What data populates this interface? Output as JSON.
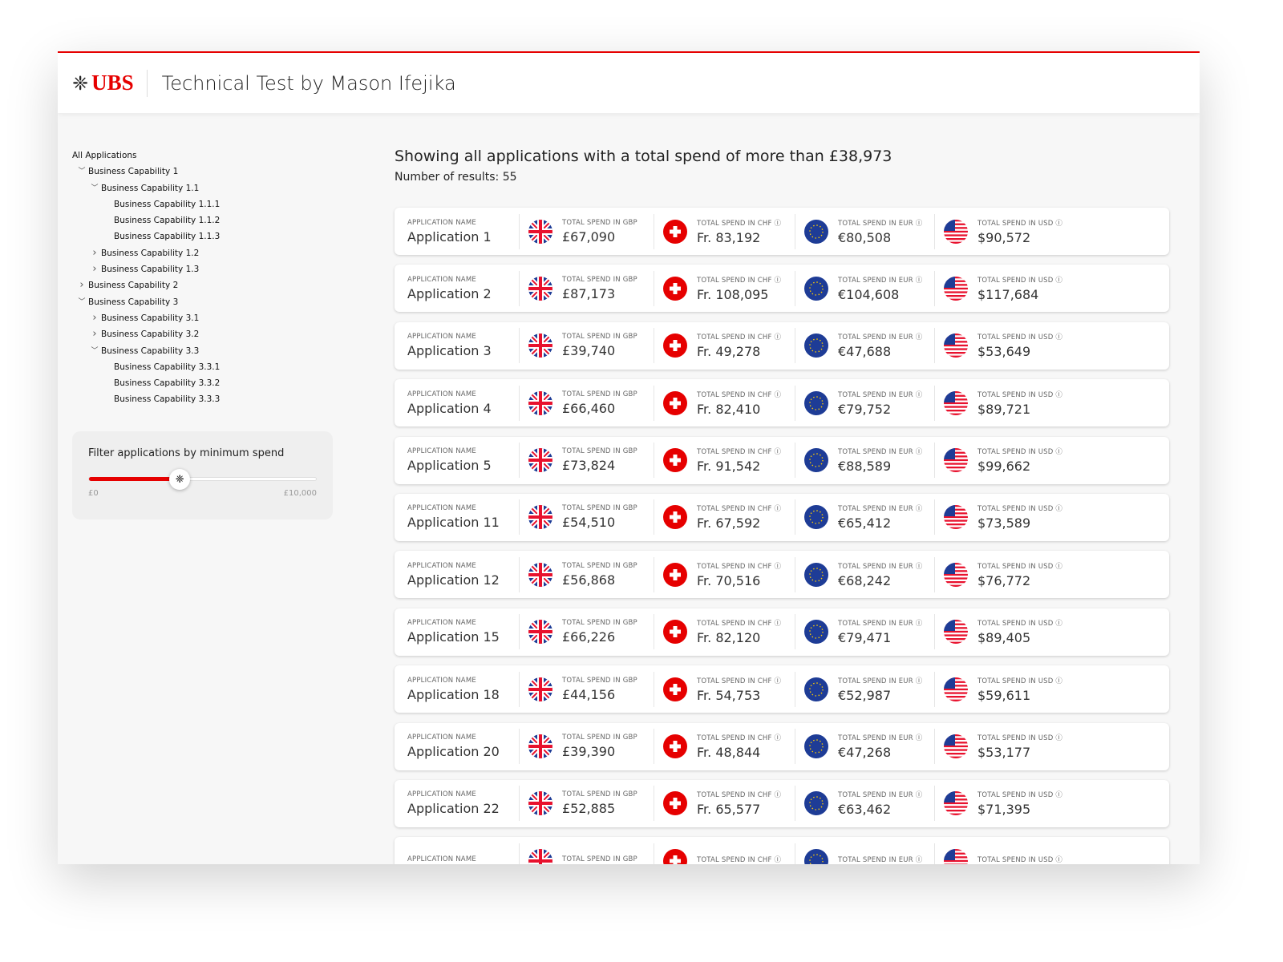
{
  "header": {
    "brand": "UBS",
    "title": "Technical Test by Mason Ifejika"
  },
  "sidebar": {
    "items": [
      {
        "label": "All Applications",
        "level": 0,
        "chevron": "none"
      },
      {
        "label": "Business Capability 1",
        "level": 1,
        "chevron": "down"
      },
      {
        "label": "Business Capability 1.1",
        "level": 2,
        "chevron": "down"
      },
      {
        "label": "Business Capability 1.1.1",
        "level": 3,
        "chevron": "none"
      },
      {
        "label": "Business Capability 1.1.2",
        "level": 3,
        "chevron": "none"
      },
      {
        "label": "Business Capability 1.1.3",
        "level": 3,
        "chevron": "none"
      },
      {
        "label": "Business Capability 1.2",
        "level": 2,
        "chevron": "right"
      },
      {
        "label": "Business Capability 1.3",
        "level": 2,
        "chevron": "right"
      },
      {
        "label": "Business Capability 2",
        "level": 1,
        "chevron": "right"
      },
      {
        "label": "Business Capability 3",
        "level": 1,
        "chevron": "down"
      },
      {
        "label": "Business Capability 3.1",
        "level": 2,
        "chevron": "right"
      },
      {
        "label": "Business Capability 3.2",
        "level": 2,
        "chevron": "right"
      },
      {
        "label": "Business Capability 3.3",
        "level": 2,
        "chevron": "down"
      },
      {
        "label": "Business Capability 3.3.1",
        "level": 3,
        "chevron": "none"
      },
      {
        "label": "Business Capability 3.3.2",
        "level": 3,
        "chevron": "none"
      },
      {
        "label": "Business Capability 3.3.3",
        "level": 3,
        "chevron": "none"
      }
    ]
  },
  "filter": {
    "label": "Filter applications by minimum spend",
    "min_label": "£0",
    "max_label": "£10,000",
    "slider_fraction": 0.4,
    "accent": "#e60000"
  },
  "main": {
    "heading": "Showing all applications with a total spend of more than £38,973",
    "count": "Number of results: 55",
    "labels": {
      "name": "Application name",
      "gbp": "Total spend in GBP",
      "chf": "Total spend in CHF ⓘ",
      "eur": "Total spend in EUR ⓘ",
      "usd": "Total spend in USD ⓘ"
    },
    "rows": [
      {
        "name": "Application 1",
        "gbp": "£67,090",
        "chf": "Fr. 83,192",
        "eur": "€80,508",
        "usd": "$90,572"
      },
      {
        "name": "Application 2",
        "gbp": "£87,173",
        "chf": "Fr. 108,095",
        "eur": "€104,608",
        "usd": "$117,684"
      },
      {
        "name": "Application 3",
        "gbp": "£39,740",
        "chf": "Fr. 49,278",
        "eur": "€47,688",
        "usd": "$53,649"
      },
      {
        "name": "Application 4",
        "gbp": "£66,460",
        "chf": "Fr. 82,410",
        "eur": "€79,752",
        "usd": "$89,721"
      },
      {
        "name": "Application 5",
        "gbp": "£73,824",
        "chf": "Fr. 91,542",
        "eur": "€88,589",
        "usd": "$99,662"
      },
      {
        "name": "Application 11",
        "gbp": "£54,510",
        "chf": "Fr. 67,592",
        "eur": "€65,412",
        "usd": "$73,589"
      },
      {
        "name": "Application 12",
        "gbp": "£56,868",
        "chf": "Fr. 70,516",
        "eur": "€68,242",
        "usd": "$76,772"
      },
      {
        "name": "Application 15",
        "gbp": "£66,226",
        "chf": "Fr. 82,120",
        "eur": "€79,471",
        "usd": "$89,405"
      },
      {
        "name": "Application 18",
        "gbp": "£44,156",
        "chf": "Fr. 54,753",
        "eur": "€52,987",
        "usd": "$59,611"
      },
      {
        "name": "Application 20",
        "gbp": "£39,390",
        "chf": "Fr. 48,844",
        "eur": "€47,268",
        "usd": "$53,177"
      },
      {
        "name": "Application 22",
        "gbp": "£52,885",
        "chf": "Fr. 65,577",
        "eur": "€63,462",
        "usd": "$71,395"
      },
      {
        "name": "",
        "gbp": "",
        "chf": "",
        "eur": "",
        "usd": ""
      }
    ]
  }
}
